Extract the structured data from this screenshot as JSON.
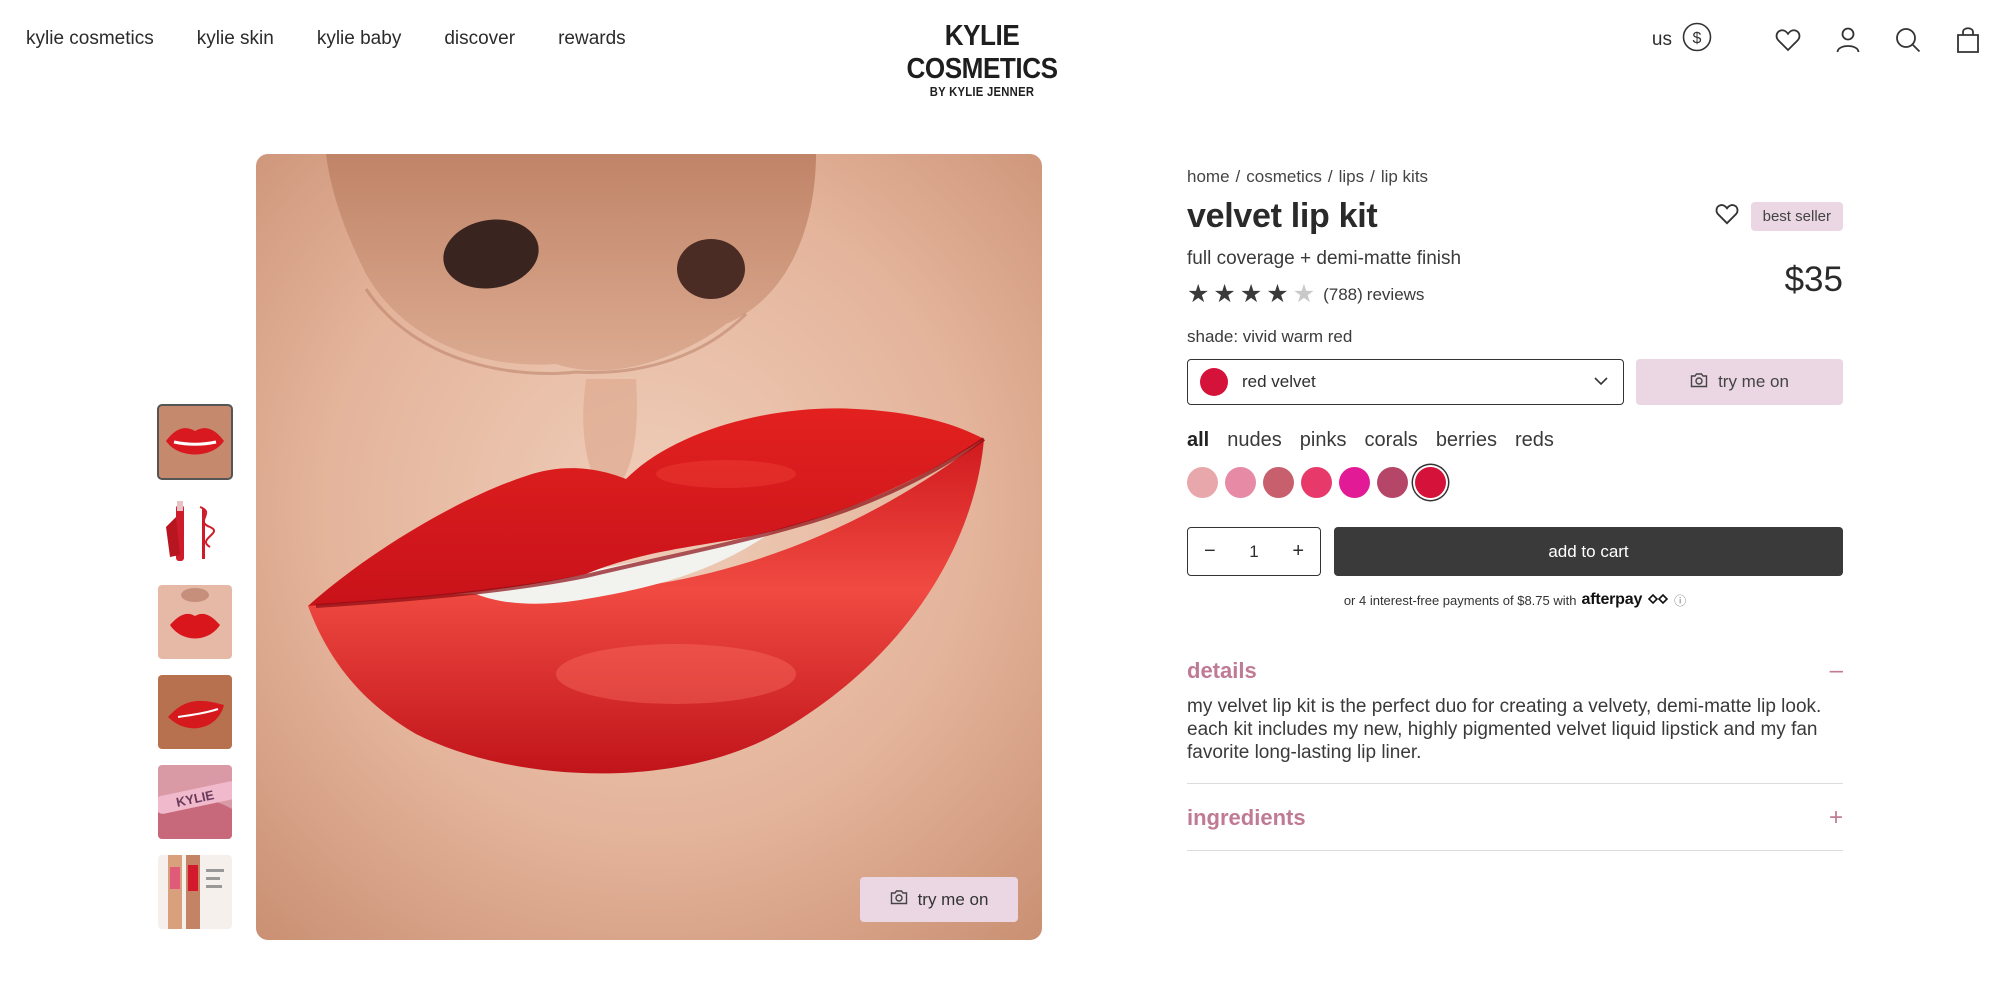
{
  "header": {
    "nav": [
      "kylie cosmetics",
      "kylie skin",
      "kylie baby",
      "discover",
      "rewards"
    ],
    "logo_main": "KYLIE COSMETICS",
    "logo_sub": "BY KYLIE JENNER",
    "region": "us",
    "icons": [
      "dollar-icon",
      "heart-icon",
      "account-icon",
      "search-icon",
      "bag-icon"
    ]
  },
  "gallery": {
    "thumbnails": [
      "lips-closeup",
      "lip-kit-product",
      "lips-face",
      "lips-side",
      "lips-gloss-tube",
      "arm-swatches"
    ],
    "active_index": 0,
    "try_on_label": "try me on"
  },
  "product": {
    "breadcrumbs": [
      "home",
      "cosmetics",
      "lips",
      "lip kits"
    ],
    "title": "velvet lip kit",
    "badge": "best seller",
    "subtitle": "full coverage + demi-matte finish",
    "rating": 4,
    "review_count": "(788)",
    "reviews_label": "reviews",
    "price": "$35",
    "shade_label": "shade: vivid warm red",
    "selected_shade": "red velvet",
    "selected_shade_color": "#d4123a",
    "try_on_label": "try me on",
    "filters": [
      "all",
      "nudes",
      "pinks",
      "corals",
      "berries",
      "reds"
    ],
    "active_filter": "all",
    "swatches": [
      "#e8a7ab",
      "#e68aa6",
      "#c75f6c",
      "#e83a6a",
      "#e31a95",
      "#b64667",
      "#d4123a"
    ],
    "selected_swatch_index": 6,
    "quantity": "1",
    "add_to_cart": "add to cart",
    "afterpay_text": "or 4 interest-free payments of $8.75 with",
    "afterpay_brand": "afterpay",
    "details_title": "details",
    "details_body": "my velvet lip kit is the perfect duo for creating a velvety, demi-matte lip look. each kit includes my new, highly pigmented velvet liquid lipstick and my fan favorite long-lasting lip liner.",
    "ingredients_title": "ingredients",
    "collapse_symbol": "–",
    "expand_symbol": "+"
  }
}
